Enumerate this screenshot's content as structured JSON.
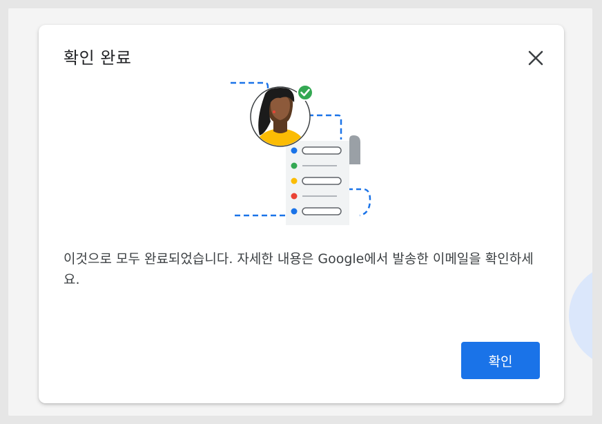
{
  "dialog": {
    "title": "확인 완료",
    "close_icon": "close-icon",
    "illustration": "person-avatar-with-checklist",
    "message": "이것으로 모두 완료되었습니다. 자세한 내용은 Google에서 발송한 이메일을 확인하세요.",
    "confirm_label": "확인"
  },
  "colors": {
    "accent": "#1a73e8",
    "success": "#34a853",
    "warning": "#fbbc04",
    "error": "#ea4335"
  }
}
